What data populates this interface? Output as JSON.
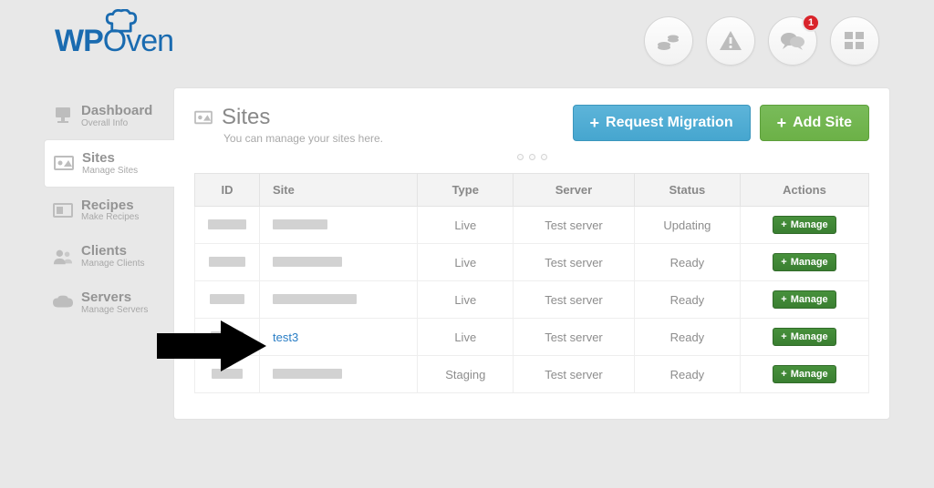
{
  "logo": {
    "text1": "WP",
    "text2": "Oven"
  },
  "topbar": {
    "badge_count": "1"
  },
  "sidebar": {
    "dashboard": {
      "title": "Dashboard",
      "sub": "Overall Info"
    },
    "sites": {
      "title": "Sites",
      "sub": "Manage Sites"
    },
    "recipes": {
      "title": "Recipes",
      "sub": "Make Recipes"
    },
    "clients": {
      "title": "Clients",
      "sub": "Manage Clients"
    },
    "servers": {
      "title": "Servers",
      "sub": "Manage Servers"
    }
  },
  "page": {
    "title": "Sites",
    "subtitle": "You can manage your sites here.",
    "request_migration_label": "Request Migration",
    "add_site_label": "Add Site"
  },
  "table": {
    "headers": {
      "id": "ID",
      "site": "Site",
      "type": "Type",
      "server": "Server",
      "status": "Status",
      "actions": "Actions"
    },
    "manage_label": "Manage",
    "rows": [
      {
        "site": "",
        "site_redacted": true,
        "type": "Live",
        "server": "Test server",
        "status": "Updating"
      },
      {
        "site": "",
        "site_redacted": true,
        "type": "Live",
        "server": "Test server",
        "status": "Ready"
      },
      {
        "site": "",
        "site_redacted": true,
        "type": "Live",
        "server": "Test server",
        "status": "Ready"
      },
      {
        "site": "test3",
        "site_redacted": false,
        "type": "Live",
        "server": "Test server",
        "status": "Ready"
      },
      {
        "site": "",
        "site_redacted": true,
        "type": "Staging",
        "server": "Test server",
        "status": "Ready"
      }
    ]
  }
}
